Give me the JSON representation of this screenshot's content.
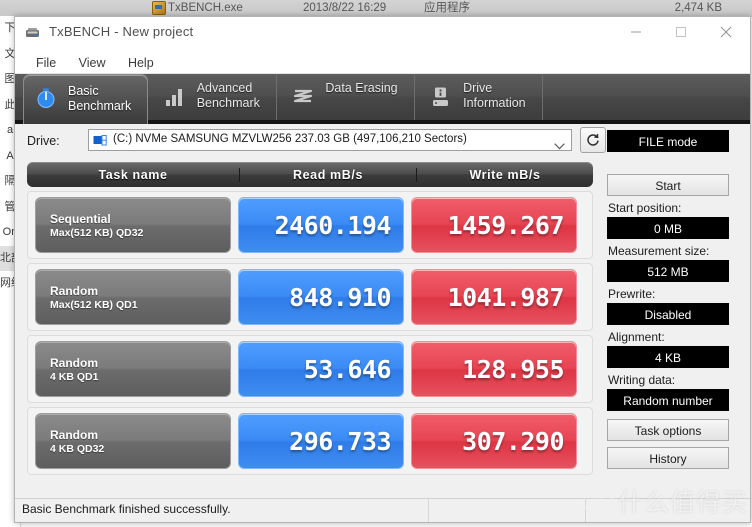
{
  "background": {
    "file_row": {
      "name": "TxBENCH.exe",
      "date": "2013/8/22 16:29",
      "type": "应用程序",
      "size": "2,474 KB"
    },
    "left_column_chars": [
      "下",
      "文",
      "图",
      "此",
      "a",
      "A",
      "隔",
      "管",
      "On",
      "北部",
      "网络"
    ]
  },
  "window": {
    "title": "TxBENCH - New project",
    "icon": "app-icon",
    "controls": {
      "minimize": "minimize-icon",
      "maximize": "maximize-icon",
      "close": "close-icon"
    }
  },
  "menu": {
    "items": [
      {
        "label": "File"
      },
      {
        "label": "View"
      },
      {
        "label": "Help"
      }
    ]
  },
  "tabs": [
    {
      "label": "Basic\nBenchmark",
      "icon": "stopwatch-icon",
      "active": true
    },
    {
      "label": "Advanced\nBenchmark",
      "icon": "bar-chart-icon",
      "active": false
    },
    {
      "label": "Data Erasing",
      "icon": "shred-icon",
      "active": false
    },
    {
      "label": "Drive\nInformation",
      "icon": "hard-drive-icon",
      "active": false
    }
  ],
  "drive": {
    "label": "Drive:",
    "value": "(C:) NVMe SAMSUNG MZVLW256  237.03 GB (497,106,210 Sectors)",
    "icon": "hdd-icon",
    "caret": "chevron-down-icon",
    "refresh": "refresh-icon"
  },
  "table": {
    "headers": {
      "task": "Task name",
      "read": "Read mB/s",
      "write": "Write mB/s"
    },
    "rows": [
      {
        "line1": "Sequential",
        "line2": "Max(512 KB) QD32",
        "read": "2460.194",
        "write": "1459.267"
      },
      {
        "line1": "Random",
        "line2": "Max(512 KB) QD1",
        "read": "848.910",
        "write": "1041.987"
      },
      {
        "line1": "Random",
        "line2": "4 KB QD1",
        "read": "53.646",
        "write": "128.955"
      },
      {
        "line1": "Random",
        "line2": "4 KB QD32",
        "read": "296.733",
        "write": "307.290"
      }
    ]
  },
  "sidebar": {
    "mode_button": "FILE mode",
    "start_button": "Start",
    "fields": [
      {
        "label": "Start position:",
        "value": "0 MB"
      },
      {
        "label": "Measurement size:",
        "value": "512 MB"
      },
      {
        "label": "Prewrite:",
        "value": "Disabled"
      },
      {
        "label": "Alignment:",
        "value": "4 KB"
      },
      {
        "label": "Writing data:",
        "value": "Random number"
      }
    ],
    "task_options_button": "Task options",
    "history_button": "History"
  },
  "statusbar": {
    "message": "Basic Benchmark finished successfully."
  },
  "watermark": {
    "mark": "值",
    "text": "什么值得买"
  },
  "colors": {
    "read_accent": "#3b8bf5",
    "write_accent": "#e84553",
    "tab_strip": "#4e4e4e",
    "value_field_bg": "#000000"
  }
}
